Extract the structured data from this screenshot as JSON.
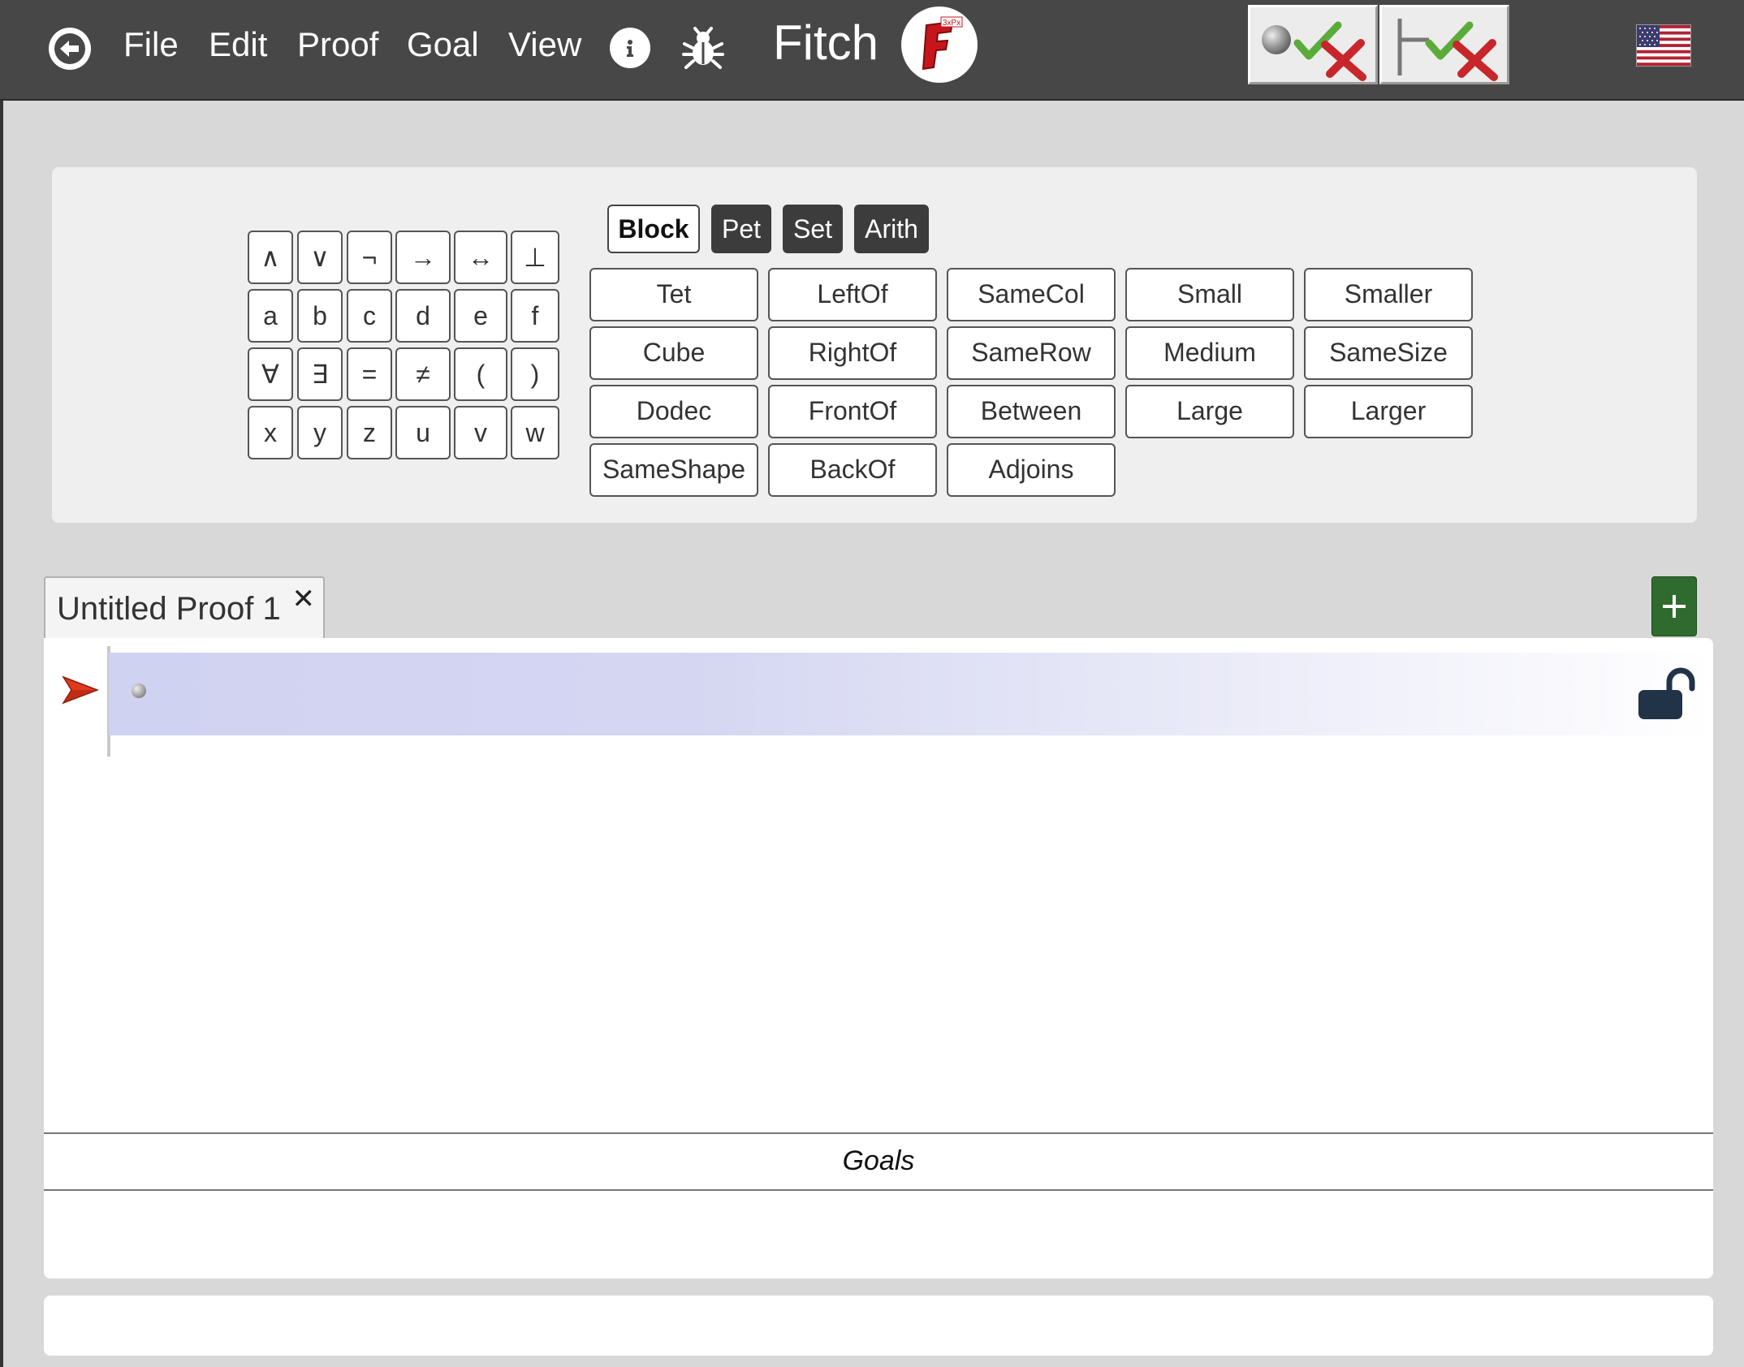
{
  "header": {
    "menus": [
      "File",
      "Edit",
      "Proof",
      "Goal",
      "View"
    ],
    "app_title": "Fitch",
    "logo_text": "F",
    "logo_badge": "3xPx"
  },
  "palette": {
    "symbols": [
      [
        "∧",
        "∨",
        "¬",
        "→",
        "↔",
        "⊥"
      ],
      [
        "a",
        "b",
        "c",
        "d",
        "e",
        "f"
      ],
      [
        "∀",
        "∃",
        "=",
        "≠",
        "(",
        ")"
      ],
      [
        "x",
        "y",
        "z",
        "u",
        "v",
        "w"
      ]
    ],
    "signature_tabs": [
      "Block",
      "Pet",
      "Set",
      "Arith"
    ],
    "active_signature": "Block",
    "predicates": [
      [
        "Tet",
        "LeftOf",
        "SameCol",
        "Small",
        "Smaller"
      ],
      [
        "Cube",
        "RightOf",
        "SameRow",
        "Medium",
        "SameSize"
      ],
      [
        "Dodec",
        "FrontOf",
        "Between",
        "Large",
        "Larger"
      ],
      [
        "SameShape",
        "BackOf",
        "Adjoins"
      ]
    ]
  },
  "proof_tabs": [
    {
      "label": "Untitled Proof 1",
      "close": "✕"
    }
  ],
  "goals": {
    "header": "Goals"
  },
  "colors": {
    "topbar": "#474747",
    "add_button": "#2f6b2f",
    "line_highlight": "#d0d2f1",
    "pointer": "#e0391d"
  }
}
